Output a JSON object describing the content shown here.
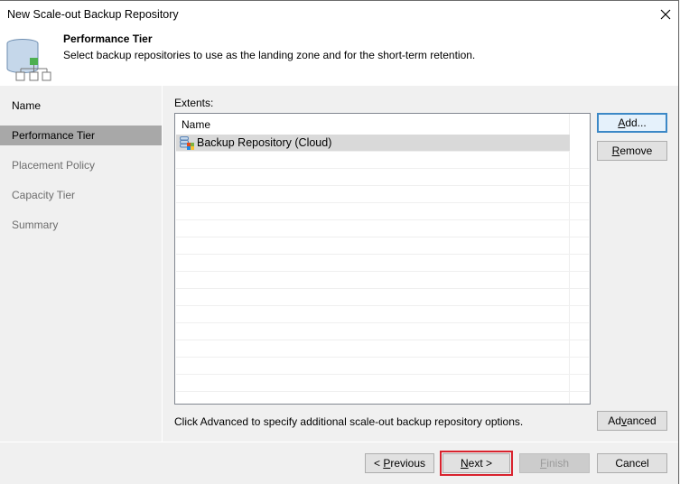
{
  "window": {
    "title": "New Scale-out Backup Repository",
    "close_icon": "close-icon"
  },
  "header": {
    "icon": "scale-out-repository-icon",
    "title": "Performance Tier",
    "description": "Select backup repositories to use as the landing zone and for the short-term retention."
  },
  "nav": {
    "items": [
      {
        "label": "Name",
        "state": "done"
      },
      {
        "label": "Performance Tier",
        "state": "active"
      },
      {
        "label": "Placement Policy",
        "state": "pending"
      },
      {
        "label": "Capacity Tier",
        "state": "pending"
      },
      {
        "label": "Summary",
        "state": "pending"
      }
    ]
  },
  "main": {
    "extents_label": "Extents:",
    "list": {
      "column_header": "Name",
      "rows": [
        {
          "name": "Backup Repository (Cloud)",
          "icon": "backup-repository-icon",
          "selected": true
        }
      ]
    },
    "buttons": {
      "add": {
        "prefix": "",
        "accel": "A",
        "rest": "dd..."
      },
      "remove": {
        "prefix": "",
        "accel": "R",
        "rest": "emove"
      },
      "advanced": {
        "prefix": "Ad",
        "accel": "v",
        "rest": "anced"
      }
    },
    "hint": "Click Advanced to specify additional scale-out backup repository options."
  },
  "footer": {
    "previous": {
      "prefix": "< ",
      "accel": "P",
      "rest": "revious"
    },
    "next": {
      "prefix": "",
      "accel": "N",
      "rest": "ext >"
    },
    "finish": {
      "prefix": "",
      "accel": "F",
      "rest": "inish"
    },
    "cancel": {
      "label": "Cancel"
    }
  },
  "colors": {
    "selected_nav": "#a8a8a8",
    "default_button_border": "#3c88c6",
    "highlight_box": "#d9232e",
    "tree_node_green": "#4caf50"
  }
}
